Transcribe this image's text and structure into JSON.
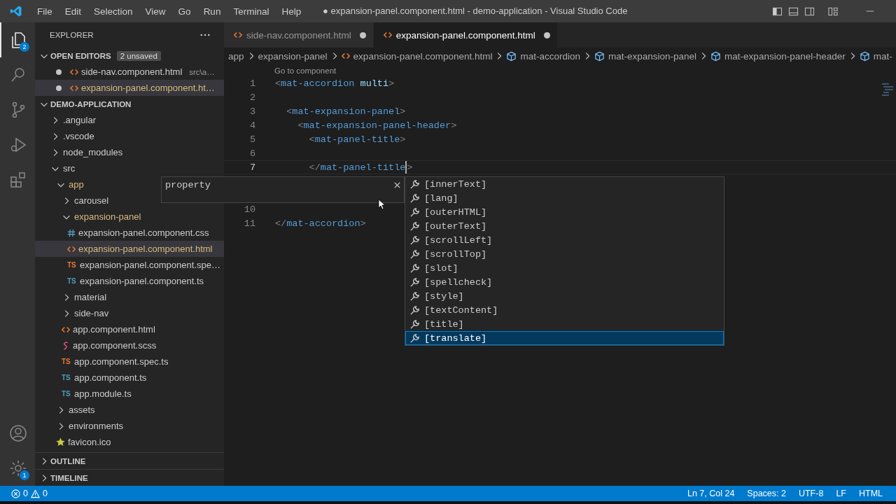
{
  "title_bar": {
    "menu": [
      "File",
      "Edit",
      "Selection",
      "View",
      "Go",
      "Run",
      "Terminal",
      "Help"
    ],
    "title": "● expansion-panel.component.html - demo-application - Visual Studio Code"
  },
  "activity_bar": {
    "items": [
      {
        "kind": "explorer",
        "selected": true,
        "badge": "2"
      },
      {
        "kind": "search",
        "selected": false
      },
      {
        "kind": "source-control",
        "selected": false
      },
      {
        "kind": "run-debug",
        "selected": false
      },
      {
        "kind": "extensions",
        "selected": false
      }
    ],
    "bottom": [
      {
        "kind": "account"
      },
      {
        "kind": "settings",
        "badge": "1"
      }
    ]
  },
  "sidebar": {
    "title": "EXPLORER",
    "open_editors": {
      "label": "OPEN EDITORS",
      "expanded": true,
      "badge": "2 unsaved",
      "items": [
        {
          "name": "side-nav.component.html",
          "path": "src\\a…",
          "kind": "html",
          "dirty": true,
          "modified": false,
          "selected": false
        },
        {
          "name": "expansion-panel.component.ht…",
          "kind": "html",
          "dirty": true,
          "modified": true,
          "selected": true
        }
      ]
    },
    "project": {
      "label": "DEMO-APPLICATION",
      "expanded": true,
      "children": [
        {
          "label": ".angular",
          "kind": "folder",
          "expanded": false,
          "modified": false,
          "selected": false
        },
        {
          "label": ".vscode",
          "kind": "folder",
          "expanded": false,
          "modified": false,
          "selected": false
        },
        {
          "label": "node_modules",
          "kind": "folder",
          "expanded": false,
          "modified": false,
          "selected": false
        },
        {
          "label": "src",
          "kind": "folder",
          "expanded": true,
          "modified": false,
          "selected": false,
          "children": [
            {
              "label": "app",
              "kind": "folder",
              "expanded": true,
              "modified": true,
              "selected": false,
              "children": [
                {
                  "label": "carousel",
                  "kind": "folder",
                  "expanded": false,
                  "modified": false,
                  "selected": false
                },
                {
                  "label": "expansion-panel",
                  "kind": "folder",
                  "expanded": true,
                  "modified": true,
                  "selected": false,
                  "children": [
                    {
                      "label": "expansion-panel.component.css",
                      "kind": "css",
                      "modified": false,
                      "selected": false
                    },
                    {
                      "label": "expansion-panel.component.html",
                      "kind": "html",
                      "modified": true,
                      "selected": true
                    },
                    {
                      "label": "expansion-panel.component.spe…",
                      "kind": "spec",
                      "icon_label": "TS",
                      "modified": false,
                      "selected": false
                    },
                    {
                      "label": "expansion-panel.component.ts",
                      "kind": "ts",
                      "icon_label": "TS",
                      "modified": false,
                      "selected": false
                    }
                  ]
                },
                {
                  "label": "material",
                  "kind": "folder",
                  "expanded": false,
                  "modified": false,
                  "selected": false
                },
                {
                  "label": "side-nav",
                  "kind": "folder",
                  "expanded": false,
                  "modified": false,
                  "selected": false
                },
                {
                  "label": "app.component.html",
                  "kind": "html",
                  "modified": false,
                  "selected": false
                },
                {
                  "label": "app.component.scss",
                  "kind": "scss",
                  "modified": false,
                  "selected": false
                },
                {
                  "label": "app.component.spec.ts",
                  "kind": "spec",
                  "icon_label": "TS",
                  "modified": false,
                  "selected": false
                },
                {
                  "label": "app.component.ts",
                  "kind": "ts",
                  "icon_label": "TS",
                  "modified": false,
                  "selected": false
                },
                {
                  "label": "app.module.ts",
                  "kind": "ts",
                  "icon_label": "TS",
                  "modified": false,
                  "selected": false
                }
              ]
            },
            {
              "label": "assets",
              "kind": "folder",
              "expanded": false,
              "modified": false,
              "selected": false
            },
            {
              "label": "environments",
              "kind": "folder",
              "expanded": false,
              "modified": false,
              "selected": false
            },
            {
              "label": "favicon.ico",
              "kind": "ico",
              "modified": false,
              "selected": false
            }
          ]
        }
      ]
    },
    "sections": [
      {
        "label": "OUTLINE",
        "expanded": false
      },
      {
        "label": "TIMELINE",
        "expanded": false
      }
    ]
  },
  "tabs": [
    {
      "label": "side-nav.component.html",
      "dirty": true,
      "selected": false
    },
    {
      "label": "expansion-panel.component.html",
      "dirty": true,
      "selected": true
    }
  ],
  "breadcrumbs": [
    {
      "label": "app",
      "kind": "folder"
    },
    {
      "label": "expansion-panel",
      "kind": "folder"
    },
    {
      "label": "expansion-panel.component.html",
      "kind": "file"
    },
    {
      "label": "mat-accordion",
      "kind": "element"
    },
    {
      "label": "mat-expansion-panel",
      "kind": "element"
    },
    {
      "label": "mat-expansion-panel-header",
      "kind": "element"
    },
    {
      "label": "mat-",
      "kind": "element"
    }
  ],
  "editor": {
    "codelens": "Go to component",
    "lines": [
      {
        "number": "1",
        "current": false,
        "tokens": [
          {
            "text": "<",
            "kind": "punct"
          },
          {
            "text": "mat-accordion",
            "kind": "tag"
          },
          {
            "text": " multi",
            "kind": "attr"
          },
          {
            "text": ">",
            "kind": "punct"
          }
        ]
      },
      {
        "number": "2",
        "current": false
      },
      {
        "number": "3",
        "current": false,
        "tokens": [
          {
            "text": "  <",
            "kind": "punct"
          },
          {
            "text": "mat-expansion-panel",
            "kind": "tag"
          },
          {
            "text": ">",
            "kind": "punct"
          }
        ]
      },
      {
        "number": "4",
        "current": false,
        "tokens": [
          {
            "text": "    <",
            "kind": "punct"
          },
          {
            "text": "mat-expansion-panel-header",
            "kind": "tag"
          },
          {
            "text": ">",
            "kind": "punct"
          }
        ]
      },
      {
        "number": "5",
        "current": false,
        "tokens": [
          {
            "text": "      <",
            "kind": "punct"
          },
          {
            "text": "mat-panel-title",
            "kind": "tag"
          },
          {
            "text": ">",
            "kind": "punct"
          }
        ]
      },
      {
        "number": "6",
        "current": false
      },
      {
        "number": "7",
        "current": true,
        "tokens": [
          {
            "text": "      </",
            "kind": "punct"
          },
          {
            "text": "mat-panel-title",
            "kind": "tag"
          },
          {
            "kind": "cursor"
          },
          {
            "text": ">",
            "kind": "punct"
          }
        ]
      },
      {
        "number": "10",
        "current": false
      },
      {
        "number": "11",
        "current": false,
        "tokens": [
          {
            "text": "</",
            "kind": "punct"
          },
          {
            "text": "mat-accordion",
            "kind": "tag"
          },
          {
            "text": ">",
            "kind": "punct"
          }
        ]
      }
    ]
  },
  "suggest": {
    "details": "property",
    "items": [
      {
        "label": "[innerText]",
        "selected": false
      },
      {
        "label": "[lang]",
        "selected": false
      },
      {
        "label": "[outerHTML]",
        "selected": false
      },
      {
        "label": "[outerText]",
        "selected": false
      },
      {
        "label": "[scrollLeft]",
        "selected": false
      },
      {
        "label": "[scrollTop]",
        "selected": false
      },
      {
        "label": "[slot]",
        "selected": false
      },
      {
        "label": "[spellcheck]",
        "selected": false
      },
      {
        "label": "[style]",
        "selected": false
      },
      {
        "label": "[textContent]",
        "selected": false
      },
      {
        "label": "[title]",
        "selected": false
      },
      {
        "label": "[translate]",
        "selected": true
      }
    ]
  },
  "status_bar": {
    "errors": "0",
    "warnings": "0",
    "right": [
      "Ln 7, Col 24",
      "Spaces: 2",
      "UTF-8",
      "LF",
      "HTML"
    ]
  }
}
